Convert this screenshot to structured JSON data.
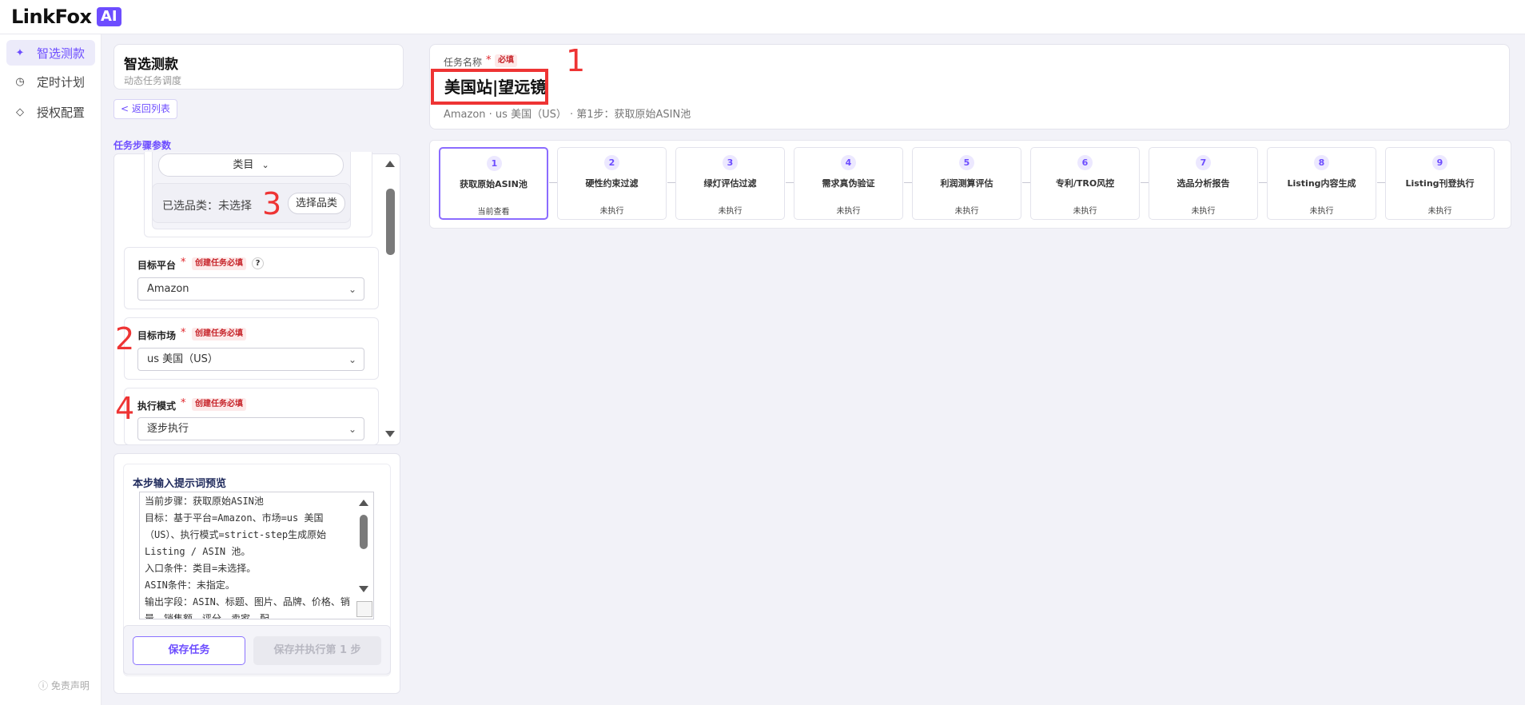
{
  "app": {
    "logo_text": "LinkFox",
    "logo_badge": "AI"
  },
  "sidebar": {
    "items": [
      {
        "label": "智选测款",
        "icon": "sparkle-icon",
        "active": true
      },
      {
        "label": "定时计划",
        "icon": "clock-icon",
        "active": false
      },
      {
        "label": "授权配置",
        "icon": "diamond-icon",
        "active": false
      }
    ],
    "disclaimer": "ⓘ 免责声明"
  },
  "left_panel": {
    "title": "智选测款",
    "subtitle": "动态任务调度",
    "back_label": "< 返回列表",
    "section_label": "任务步骤参数",
    "category": {
      "pill_label": "类目",
      "selected_text": "已选品类：未选择",
      "select_button": "选择品类"
    },
    "fields": [
      {
        "label": "目标平台",
        "required_badge": "创建任务必填",
        "value": "Amazon",
        "has_help": true,
        "help": "?"
      },
      {
        "label": "目标市场",
        "required_badge": "创建任务必填",
        "value": "us 美国（US）"
      },
      {
        "label": "执行模式",
        "required_badge": "创建任务必填",
        "value": "逐步执行"
      }
    ],
    "prompt_preview": {
      "title": "本步输入提示词预览",
      "text": "当前步骤：获取原始ASIN池\n目标：基于平台=Amazon、市场=us 美国（US）、执行模式=strict-step生成原始 Listing / ASIN 池。\n入口条件：类目=未选择。\nASIN条件：未指定。\n输出字段：ASIN、标题、图片、品牌、价格、销量、销售额、评分、卖家、配"
    },
    "actions": {
      "save": "保存任务",
      "save_run": "保存并执行第 1 步"
    }
  },
  "task": {
    "name_label": "任务名称",
    "required_star": "*",
    "required_badge": "必填",
    "name_value": "美国站|望远镜",
    "meta": "Amazon · us 美国（US） · 第1步：获取原始ASIN池"
  },
  "steps": [
    {
      "num": "1",
      "name": "获取原始ASIN池",
      "status": "当前查看",
      "active": true
    },
    {
      "num": "2",
      "name": "硬性约束过滤",
      "status": "未执行"
    },
    {
      "num": "3",
      "name": "绿灯评估过滤",
      "status": "未执行"
    },
    {
      "num": "4",
      "name": "需求真伪验证",
      "status": "未执行"
    },
    {
      "num": "5",
      "name": "利润测算评估",
      "status": "未执行"
    },
    {
      "num": "6",
      "name": "专利/TRO风控",
      "status": "未执行"
    },
    {
      "num": "7",
      "name": "选品分析报告",
      "status": "未执行"
    },
    {
      "num": "8",
      "name": "Listing内容生成",
      "status": "未执行"
    },
    {
      "num": "9",
      "name": "Listing刊登执行",
      "status": "未执行"
    }
  ],
  "annotations": [
    "1",
    "2",
    "3",
    "4"
  ],
  "colors": {
    "accent": "#6d4dff",
    "required": "#e0282e",
    "annotation": "#ee3434"
  }
}
